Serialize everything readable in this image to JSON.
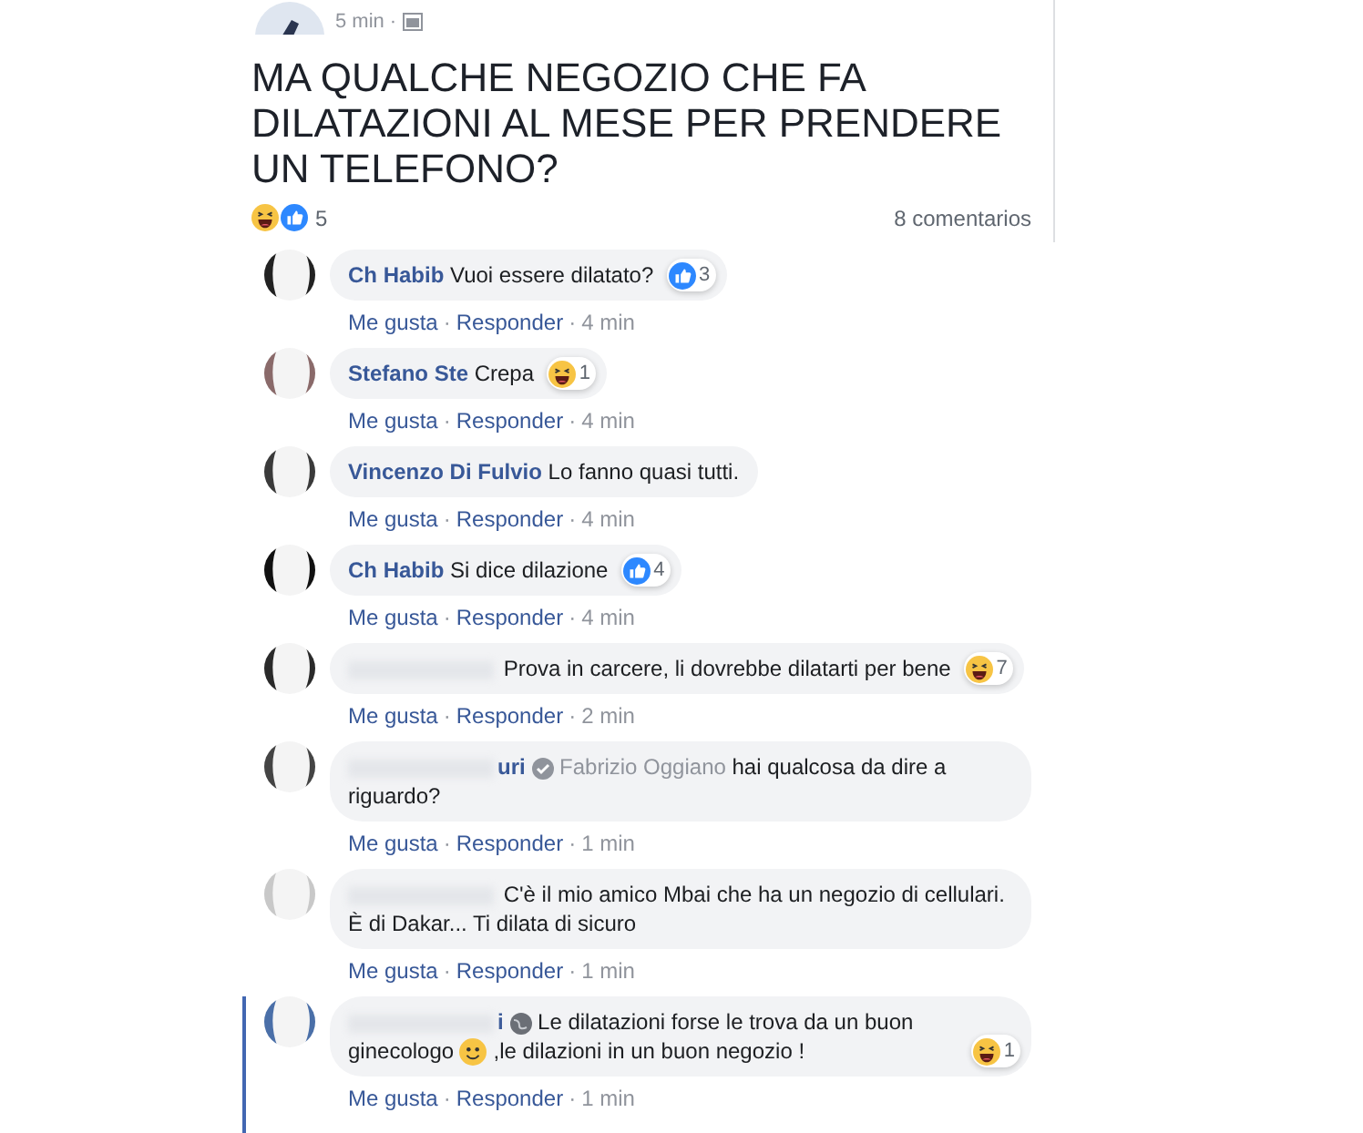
{
  "post": {
    "time": "5 min",
    "separator": "·",
    "title": "MA QUALCHE NEGOZIO CHE FA DILATAZIONI AL MESE PER PRENDERE UN TELEFONO?",
    "reactions": [
      {
        "kind": "haha"
      },
      {
        "kind": "like"
      }
    ],
    "reaction_count": "5",
    "comment_count": "8 comentarios"
  },
  "comments": [
    {
      "name": "Ch Habib",
      "name_redacted": false,
      "text": "Vuoi essere dilatato?",
      "reaction": {
        "kind": "like",
        "count": "3"
      },
      "meta": [
        {
          "kind": "link",
          "text": "Me gusta"
        },
        {
          "kind": "sep",
          "text": "·"
        },
        {
          "kind": "link",
          "text": "Responder"
        },
        {
          "kind": "sep",
          "text": "·"
        },
        {
          "kind": "time",
          "text": "4 min"
        }
      ],
      "highlighted": false
    },
    {
      "name": "Stefano Ste",
      "name_redacted": false,
      "text": "Crepa",
      "reaction": {
        "kind": "haha",
        "count": "1"
      },
      "meta": [
        {
          "kind": "link",
          "text": "Me gusta"
        },
        {
          "kind": "sep",
          "text": "·"
        },
        {
          "kind": "link",
          "text": "Responder"
        },
        {
          "kind": "sep",
          "text": "·"
        },
        {
          "kind": "time",
          "text": "4 min"
        }
      ],
      "highlighted": false
    },
    {
      "name": "Vincenzo Di Fulvio",
      "name_redacted": false,
      "text": "Lo fanno quasi tutti.",
      "meta": [
        {
          "kind": "link",
          "text": "Me gusta"
        },
        {
          "kind": "sep",
          "text": "·"
        },
        {
          "kind": "link",
          "text": "Responder"
        },
        {
          "kind": "sep",
          "text": "·"
        },
        {
          "kind": "time",
          "text": "4 min"
        }
      ],
      "highlighted": false
    },
    {
      "name": "Ch Habib",
      "name_redacted": false,
      "text": "Si dice dilazione",
      "reaction": {
        "kind": "like",
        "count": "4"
      },
      "meta": [
        {
          "kind": "link",
          "text": "Me gusta"
        },
        {
          "kind": "sep",
          "text": "·"
        },
        {
          "kind": "link",
          "text": "Responder"
        },
        {
          "kind": "sep",
          "text": "·"
        },
        {
          "kind": "time",
          "text": "4 min"
        }
      ],
      "highlighted": false
    },
    {
      "name_redacted": true,
      "text": "Prova in carcere, li dovrebbe dilatarti per bene",
      "reaction": {
        "kind": "haha",
        "count": "7"
      },
      "meta": [
        {
          "kind": "link",
          "text": "Me gusta"
        },
        {
          "kind": "sep",
          "text": "·"
        },
        {
          "kind": "link",
          "text": "Responder"
        },
        {
          "kind": "sep",
          "text": "·"
        },
        {
          "kind": "time",
          "text": "2 min"
        }
      ],
      "highlighted": false
    },
    {
      "name": "uri",
      "name_redacted": true,
      "badge": {
        "kind": "check"
      },
      "mention": "Fabrizio Oggiano",
      "text": "hai qualcosa da dire a riguardo?",
      "meta": [
        {
          "kind": "link",
          "text": "Me gusta"
        },
        {
          "kind": "sep",
          "text": "·"
        },
        {
          "kind": "link",
          "text": "Responder"
        },
        {
          "kind": "sep",
          "text": "·"
        },
        {
          "kind": "time",
          "text": "1 min"
        }
      ],
      "highlighted": false
    },
    {
      "name_redacted": true,
      "text": "C'è il mio amico Mbai che ha un negozio di cellulari. È di Dakar... Ti dilata di sicuro",
      "meta": [
        {
          "kind": "link",
          "text": "Me gusta"
        },
        {
          "kind": "sep",
          "text": "·"
        },
        {
          "kind": "link",
          "text": "Responder"
        },
        {
          "kind": "sep",
          "text": "·"
        },
        {
          "kind": "time",
          "text": "1 min"
        }
      ],
      "highlighted": false
    },
    {
      "name": "i",
      "name_redacted": true,
      "badge": {
        "kind": "globe"
      },
      "text": "Le dilatazioni forse le trova da un buon ginecologo",
      "emoji": {
        "kind": "smile"
      },
      "text_after": ",le dilazioni in un buon negozio !",
      "reaction": {
        "kind": "haha",
        "count": "1"
      },
      "meta": [
        {
          "kind": "link",
          "text": "Me gusta"
        },
        {
          "kind": "sep",
          "text": "·"
        },
        {
          "kind": "link",
          "text": "Responder"
        },
        {
          "kind": "sep",
          "text": "·"
        },
        {
          "kind": "time",
          "text": "1 min"
        }
      ],
      "highlighted": true
    }
  ]
}
